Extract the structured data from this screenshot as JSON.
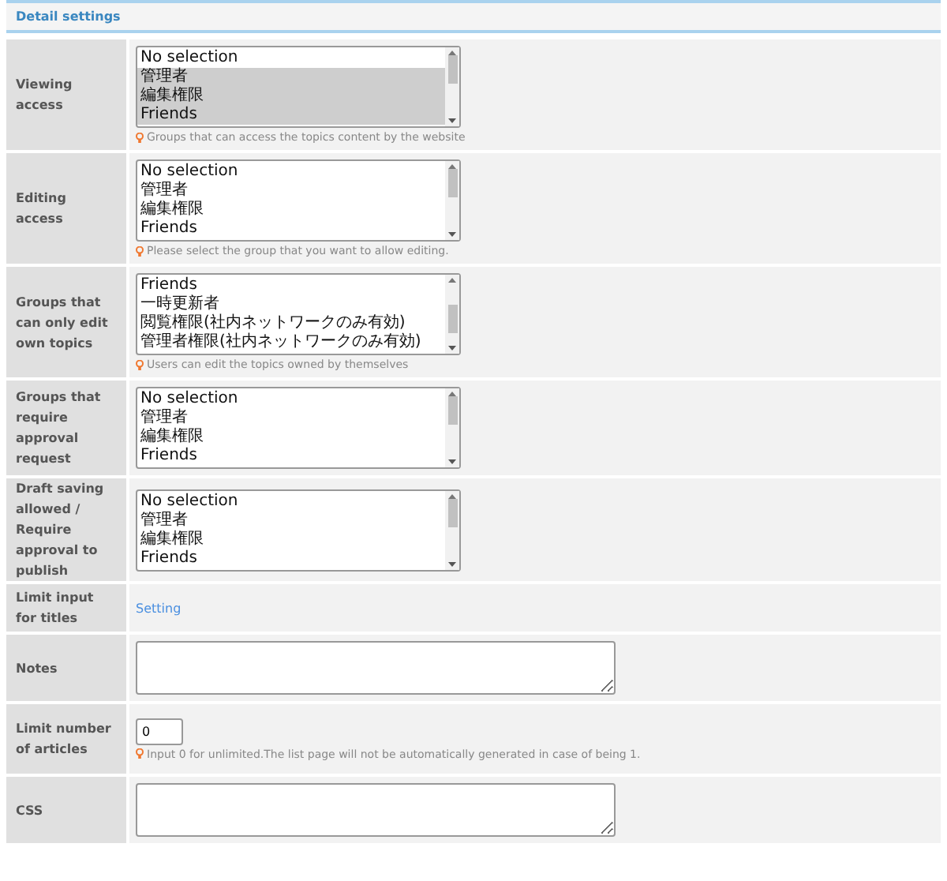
{
  "section_title": "Detail settings",
  "rows": [
    {
      "label": "Viewing access",
      "kind": "listbox",
      "scrolled": false,
      "options": [
        {
          "text": "No selection",
          "selected": false
        },
        {
          "text": "管理者",
          "selected": true
        },
        {
          "text": "編集権限",
          "selected": true
        },
        {
          "text": "Friends",
          "selected": true
        }
      ],
      "hint": "Groups that can access the topics content by the website"
    },
    {
      "label": "Editing access",
      "kind": "listbox",
      "scrolled": false,
      "options": [
        {
          "text": "No selection",
          "selected": false
        },
        {
          "text": "管理者",
          "selected": false
        },
        {
          "text": "編集権限",
          "selected": false
        },
        {
          "text": "Friends",
          "selected": false
        }
      ],
      "hint": "Please select the group that you want to allow editing."
    },
    {
      "label": "Groups that can only edit own topics",
      "kind": "listbox",
      "scrolled": true,
      "options": [
        {
          "text": "Friends",
          "selected": false
        },
        {
          "text": "一時更新者",
          "selected": false
        },
        {
          "text": "閲覧権限(社内ネットワークのみ有効)",
          "selected": false
        },
        {
          "text": "管理者権限(社内ネットワークのみ有効)",
          "selected": false
        }
      ],
      "hint": "Users can edit the topics owned by themselves"
    },
    {
      "label": "Groups that require approval request",
      "kind": "listbox",
      "scrolled": false,
      "options": [
        {
          "text": "No selection",
          "selected": false
        },
        {
          "text": "管理者",
          "selected": false
        },
        {
          "text": "編集権限",
          "selected": false
        },
        {
          "text": "Friends",
          "selected": false
        }
      ]
    },
    {
      "label": "Draft saving allowed / Require approval to publish",
      "kind": "listbox",
      "scrolled": false,
      "options": [
        {
          "text": "No selection",
          "selected": false
        },
        {
          "text": "管理者",
          "selected": false
        },
        {
          "text": "編集権限",
          "selected": false
        },
        {
          "text": "Friends",
          "selected": false
        }
      ]
    },
    {
      "label": "Limit input for titles",
      "kind": "link",
      "link": "Setting"
    },
    {
      "label": "Notes",
      "kind": "textarea"
    },
    {
      "label": "Limit number of articles",
      "kind": "number",
      "value": "0",
      "hint": "Input 0 for unlimited.The list page will not be automatically generated in case of being 1."
    },
    {
      "label": "CSS",
      "kind": "textarea"
    }
  ]
}
